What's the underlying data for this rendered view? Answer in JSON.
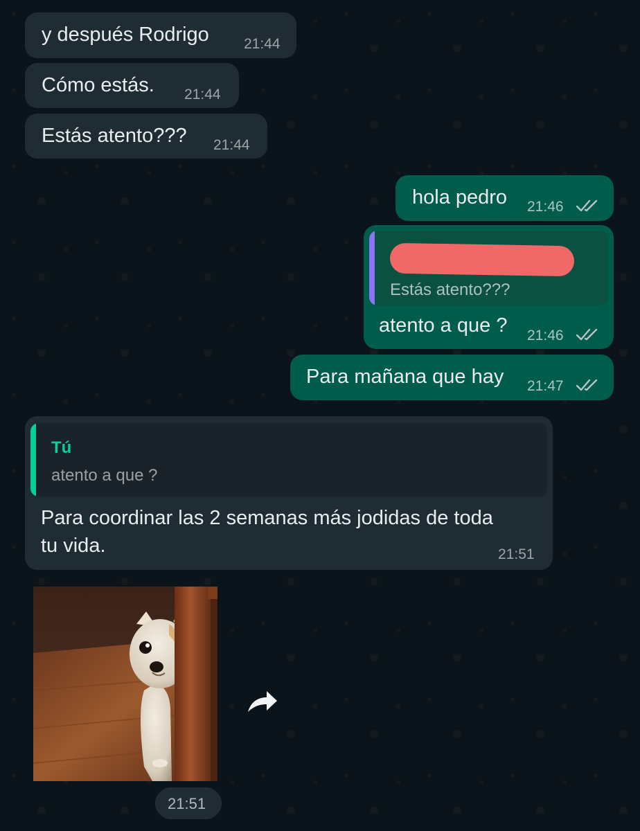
{
  "messages": [
    {
      "text": "y después Rodrigo",
      "time": "21:44"
    },
    {
      "text": "Cómo estás.",
      "time": "21:44"
    },
    {
      "text": "Estás atento???",
      "time": "21:44"
    },
    {
      "text": "hola pedro",
      "time": "21:46"
    },
    {
      "quote_text": "Estás atento???",
      "text": "atento a que ?",
      "time": "21:46"
    },
    {
      "text": "Para mañana que hay",
      "time": "21:47"
    },
    {
      "quote_author": "Tú",
      "quote_text": "atento a que ?",
      "text_line1": "Para coordinar las 2 semanas más jodidas de toda",
      "text_line2": "tu vida.",
      "time": "21:51"
    },
    {
      "time": "21:51"
    }
  ],
  "icons": {
    "read_receipt": "double-check-icon",
    "forward": "forward-arrow-icon"
  },
  "colors": {
    "background": "#0b141a",
    "incoming_bubble": "#202c33",
    "outgoing_bubble": "#005c4b",
    "quote_accent_incoming": "#06cf9c",
    "quote_accent_outgoing": "#8a73f4",
    "redaction": "#f06868"
  }
}
